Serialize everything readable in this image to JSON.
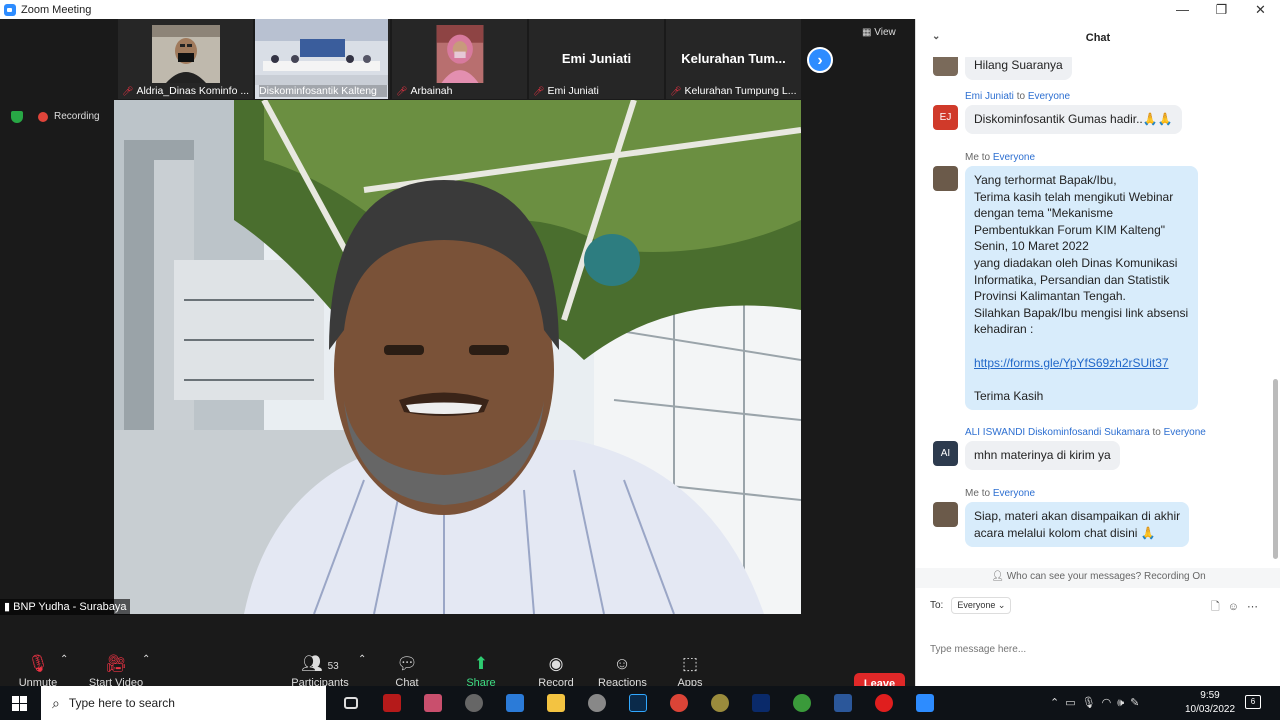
{
  "window": {
    "title": "Zoom Meeting"
  },
  "strip": {
    "tiles": [
      {
        "name": "Aldria_Dinas Kominfo ..."
      },
      {
        "name": "Diskominfosantik Kalteng"
      },
      {
        "name": "Arbainah"
      },
      {
        "name": "Emi Juniati",
        "big": "Emi Juniati"
      },
      {
        "name": "Kelurahan Tumpung L...",
        "big": "Kelurahan Tum..."
      }
    ],
    "view_label": "View"
  },
  "status": {
    "recording": "Recording"
  },
  "speaker": {
    "name": "BNP Yudha - Surabaya"
  },
  "toolbar": {
    "unmute": "Unmute",
    "start_video": "Start Video",
    "participants": "Participants",
    "participants_count": "53",
    "chat": "Chat",
    "share_screen": "Share Screen",
    "record": "Record",
    "reactions": "Reactions",
    "apps": "Apps",
    "leave": "Leave"
  },
  "chat": {
    "title": "Chat",
    "messages": [
      {
        "text": "Hilang Suaranya"
      },
      {
        "sender": "Emi Juniati",
        "to_word": "to",
        "to": "Everyone",
        "initials": "EJ",
        "text": "Diskominfosantik Gumas hadir..🙏🙏"
      },
      {
        "sender": "Me",
        "to_word": "to",
        "to": "Everyone",
        "lines": [
          "Yang terhormat Bapak/Ibu,",
          "Terima kasih telah mengikuti Webinar",
          "dengan tema \"Mekanisme",
          "Pembentukkan Forum KIM Kalteng\"",
          "Senin, 10 Maret 2022",
          "yang diadakan oleh Dinas Komunikasi",
          "Informatika, Persandian dan Statistik",
          "Provinsi Kalimantan Tengah.",
          "Silahkan Bapak/Ibu mengisi link absensi",
          "kehadiran :"
        ],
        "link": "https://forms.gle/YpYfS69zh2rSUit37",
        "closing": "Terima Kasih"
      },
      {
        "sender": "ALI ISWANDI Diskominfosandi Sukamara",
        "to_word": "to",
        "to": "Everyone",
        "initials": "AI",
        "text": "mhn materinya di kirim ya"
      },
      {
        "sender": "Me",
        "to_word": "to",
        "to": "Everyone",
        "lines": [
          "Siap, materi akan disampaikan di akhir",
          "acara melalui kolom chat disini 🙏"
        ]
      }
    ],
    "who_can_see": "Who can see your messages? Recording On",
    "to_label": "To:",
    "to_value": "Everyone",
    "placeholder": "Type message here..."
  },
  "taskbar": {
    "search_placeholder": "Type here to search",
    "time": "9:59",
    "date": "10/03/2022",
    "notifications": "6"
  }
}
